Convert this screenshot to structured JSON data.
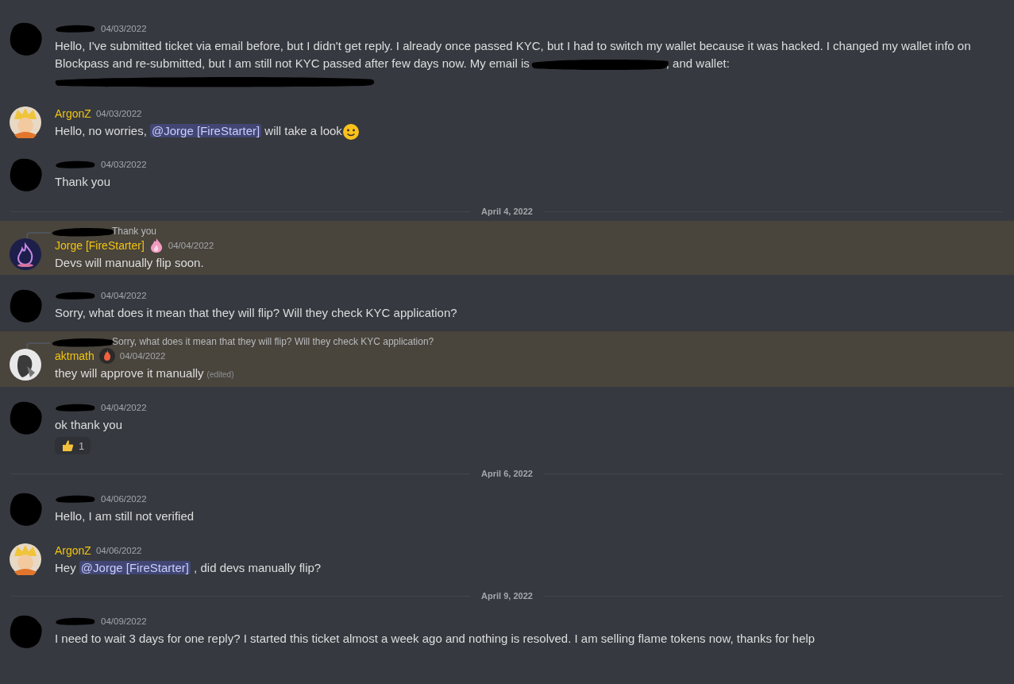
{
  "messages": [
    {
      "kind": "message",
      "avatar": {
        "kind": "redacted"
      },
      "timestamp": "04/03/2022",
      "highlighted": false,
      "content": [
        {
          "kind": "text",
          "text": "Hello, I've submitted ticket via email before, but I didn't get reply. I already once passed KYC, but I had to switch my wallet because it was hacked. I changed my wallet info on Blockpass and re-submitted, but I am still not KYC passed after few days now. My email is"
        },
        {
          "kind": "redaction"
        },
        {
          "kind": "text",
          "text": ", and wallet:"
        },
        {
          "kind": "break"
        },
        {
          "kind": "redaction-long"
        }
      ]
    },
    {
      "kind": "message",
      "avatar": {
        "kind": "cartoon"
      },
      "author": "ArgonZ",
      "timestamp": "04/03/2022",
      "highlighted": false,
      "content": [
        {
          "kind": "text",
          "text": "Hello, no worries, "
        },
        {
          "kind": "mention",
          "text": "@Jorge [FireStarter]"
        },
        {
          "kind": "text",
          "text": " will take a look"
        },
        {
          "kind": "emoji"
        }
      ]
    },
    {
      "kind": "message",
      "avatar": {
        "kind": "redacted"
      },
      "timestamp": "04/03/2022",
      "highlighted": false,
      "content": [
        {
          "kind": "text",
          "text": "Thank you"
        }
      ]
    },
    {
      "kind": "divider",
      "text": "April 4, 2022"
    },
    {
      "kind": "message",
      "avatar": {
        "kind": "flame"
      },
      "author": "Jorge [FireStarter]",
      "badge": {
        "kind": "pink-flame"
      },
      "timestamp": "04/04/2022",
      "highlighted": true,
      "reply": "Thank you",
      "content": [
        {
          "kind": "text",
          "text": "Devs will manually flip soon."
        }
      ]
    },
    {
      "kind": "message",
      "avatar": {
        "kind": "redacted"
      },
      "timestamp": "04/04/2022",
      "highlighted": false,
      "content": [
        {
          "kind": "text",
          "text": "Sorry, what does it mean that they will flip? Will they check KYC application?"
        }
      ]
    },
    {
      "kind": "message",
      "avatar": {
        "kind": "mono"
      },
      "author": "aktmath",
      "badge": {
        "kind": "flame-circle"
      },
      "timestamp": "04/04/2022",
      "highlighted": true,
      "reply": "Sorry, what does it mean that they will flip? Will they check KYC application?",
      "edited": "(edited)",
      "content": [
        {
          "kind": "text",
          "text": "they will  approve it manually"
        }
      ]
    },
    {
      "kind": "message",
      "avatar": {
        "kind": "redacted"
      },
      "timestamp": "04/04/2022",
      "highlighted": false,
      "reaction": {
        "count": "1"
      },
      "content": [
        {
          "kind": "text",
          "text": "ok thank you"
        }
      ]
    },
    {
      "kind": "divider",
      "text": "April 6, 2022"
    },
    {
      "kind": "message",
      "avatar": {
        "kind": "redacted"
      },
      "timestamp": "04/06/2022",
      "highlighted": false,
      "content": [
        {
          "kind": "text",
          "text": "Hello, I am still not verified"
        }
      ]
    },
    {
      "kind": "message",
      "avatar": {
        "kind": "cartoon"
      },
      "author": "ArgonZ",
      "timestamp": "04/06/2022",
      "highlighted": false,
      "content": [
        {
          "kind": "text",
          "text": "Hey "
        },
        {
          "kind": "mention",
          "text": "@Jorge [FireStarter]"
        },
        {
          "kind": "text",
          "text": " , did devs manually flip?"
        }
      ]
    },
    {
      "kind": "divider",
      "text": "April 9, 2022"
    },
    {
      "kind": "message",
      "avatar": {
        "kind": "redacted"
      },
      "timestamp": "04/09/2022",
      "highlighted": false,
      "content": [
        {
          "kind": "text",
          "text": "I need to wait 3 days for one reply? I started this ticket almost a week ago and nothing is resolved. I am selling flame tokens now, thanks for help"
        }
      ]
    }
  ]
}
